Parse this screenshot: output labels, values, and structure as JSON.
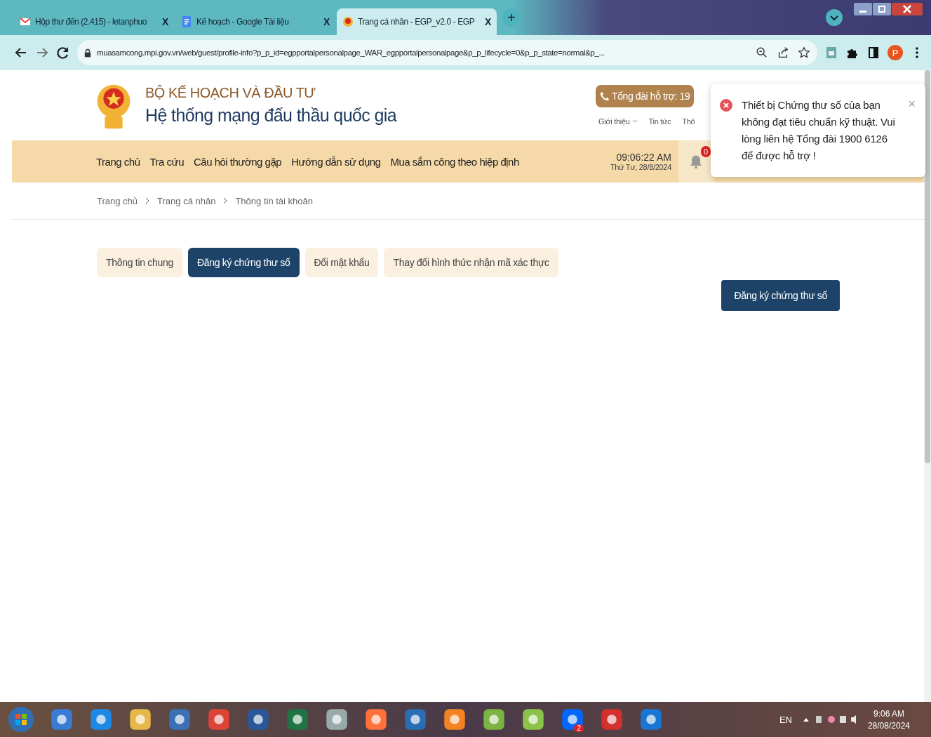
{
  "browser": {
    "tabs": [
      {
        "title": "Hộp thư đến (2.415) - letanphuo",
        "close": "X",
        "selected": false,
        "kind": "mail"
      },
      {
        "title": "Kế hoạch - Google Tài liệu",
        "close": "X",
        "selected": false,
        "kind": "doc"
      },
      {
        "title": "Trang cá nhân - EGP_v2.0 - EGP",
        "close": "X",
        "selected": true,
        "kind": "site"
      }
    ],
    "new_tab": "+",
    "url": "muasamcong.mpi.gov.vn/web/guest/profile-info?p_p_id=egpportalpersonalpage_WAR_egpportalpersonalpage&p_p_lifecycle=0&p_p_state=normal&p_...",
    "profile": "P"
  },
  "header": {
    "ministry": "BỘ KẾ HOẠCH VÀ ĐẦU TƯ",
    "system": "Hệ thống mạng đấu thầu quốc gia",
    "hotline": "Tổng đài hỗ trợ: 19",
    "links": [
      "Giới thiệu",
      "Tin tức",
      "Thô"
    ]
  },
  "nav": {
    "items": [
      "Trang chủ",
      "Tra cứu",
      "Câu hỏi thường gặp",
      "Hướng dẫn sử dụng",
      "Mua sắm công theo hiệp định"
    ],
    "time": "09:06:22 AM",
    "date": "Thứ Tư, 28/8/2024",
    "notifications": "0"
  },
  "breadcrumb": [
    "Trang chủ",
    "Trang cá nhân",
    "Thông tin tài khoản"
  ],
  "tabs": [
    {
      "label": "Thông tin chung",
      "selected": false
    },
    {
      "label": "Đăng ký chứng thư số",
      "selected": true
    },
    {
      "label": "Đổi mật khẩu",
      "selected": false
    },
    {
      "label": "Thay đổi hình thức nhận mã xác thực",
      "selected": false
    }
  ],
  "register_button": "Đăng ký chứng thư số",
  "toast": {
    "message": "Thiết bị Chứng thư số của bạn không đạt tiêu chuẩn kỹ thuật. Vui lòng liên hệ Tổng đài 1900 6126 để được hỗ trợ !",
    "close": "×"
  },
  "taskbar": {
    "zalo_badge": "2",
    "language": "EN",
    "time": "9:06 AM",
    "date": "28/08/2024"
  }
}
